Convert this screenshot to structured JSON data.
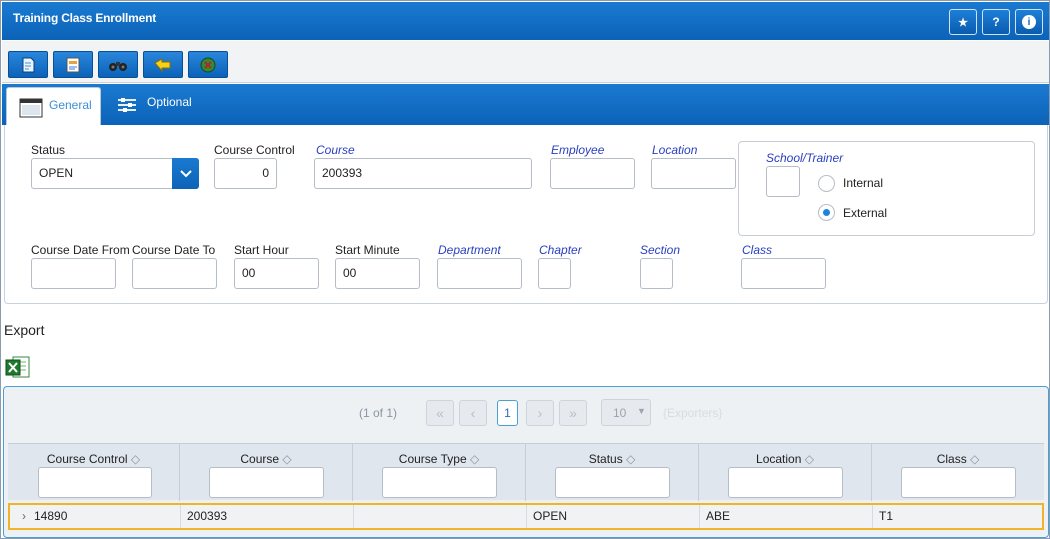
{
  "window": {
    "title": "Training Class Enrollment",
    "buttons": {
      "favorite": "★",
      "help": "?",
      "info": "i"
    }
  },
  "toolbar": {
    "tools": [
      "new-document-icon",
      "report-icon",
      "binoculars-icon",
      "back-arrow-icon",
      "exit-icon"
    ]
  },
  "tabs": {
    "general": "General",
    "optional": "Optional"
  },
  "form": {
    "status": {
      "label": "Status",
      "value": "OPEN"
    },
    "course_control": {
      "label": "Course Control",
      "value": "0"
    },
    "course": {
      "label": "Course",
      "value": "200393"
    },
    "employee": {
      "label": "Employee",
      "value": ""
    },
    "location": {
      "label": "Location",
      "value": ""
    },
    "school_trainer": {
      "label": "School/Trainer",
      "value": "",
      "options": [
        "Internal",
        "External"
      ],
      "selected": "External"
    },
    "course_date_from": {
      "label": "Course Date From",
      "value": ""
    },
    "course_date_to": {
      "label": "Course Date To",
      "value": ""
    },
    "start_hour": {
      "label": "Start Hour",
      "value": "00"
    },
    "start_minute": {
      "label": "Start Minute",
      "value": "00"
    },
    "department": {
      "label": "Department",
      "value": ""
    },
    "chapter": {
      "label": "Chapter",
      "value": ""
    },
    "section": {
      "label": "Section",
      "value": ""
    },
    "class": {
      "label": "Class",
      "value": ""
    }
  },
  "export": {
    "title": "Export",
    "icon": "excel-icon"
  },
  "pager": {
    "info": "(1 of 1)",
    "current_page": "1",
    "page_size": "10",
    "exporters": "{Exporters}"
  },
  "table": {
    "columns": [
      "Course Control",
      "Course",
      "Course Type",
      "Status",
      "Location",
      "Class"
    ],
    "rows": [
      {
        "course_control": "14890",
        "course": "200393",
        "course_type": "",
        "status": "OPEN",
        "location": "ABE",
        "class": "T1"
      }
    ]
  }
}
